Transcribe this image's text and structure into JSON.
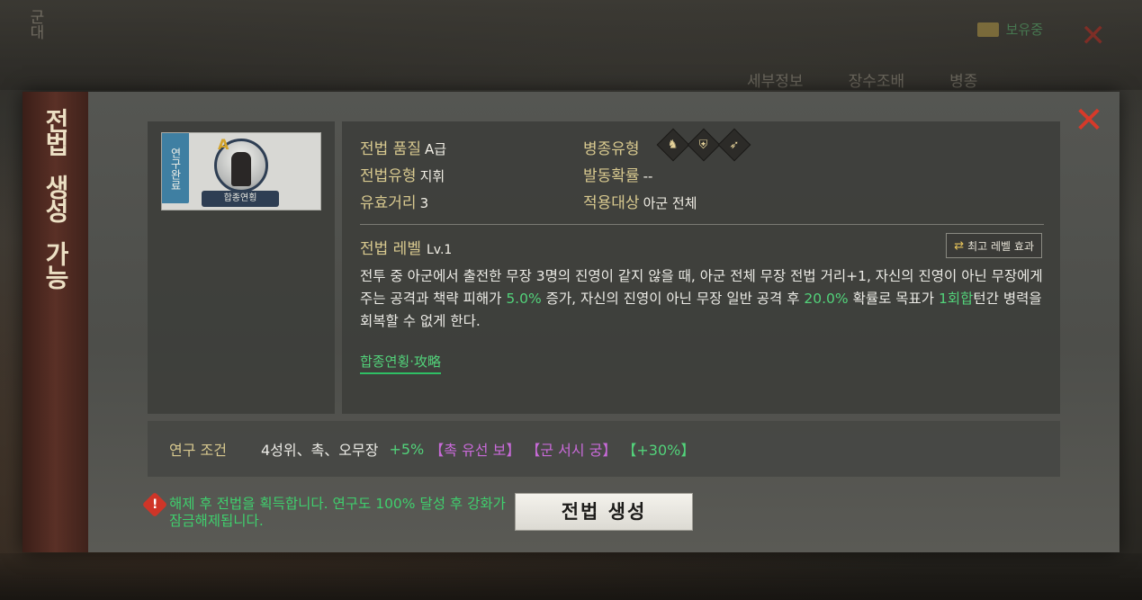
{
  "background": {
    "tabs": [
      "세부정보",
      "장수조배",
      "병종"
    ],
    "top_right_text": "보유중",
    "left_col_text": "군대"
  },
  "side_banner": {
    "line1": "전법",
    "line2": "생성",
    "line3": "가능"
  },
  "close_label": "✕",
  "card": {
    "ribbon": "연구완료",
    "grade": "A",
    "name": "합종연횡"
  },
  "attributes": {
    "quality_label": "전법 품질",
    "quality_value": "A급",
    "type_label": "전법유형",
    "type_value": "지휘",
    "range_label": "유효거리",
    "range_value": "3",
    "troop_label": "병종유형",
    "trigger_label": "발동확률",
    "trigger_value": "--",
    "target_label": "적용대상",
    "target_value": "아군 전체"
  },
  "troop_icons": [
    "cavalry-icon",
    "shield-icon",
    "bow-icon"
  ],
  "level": {
    "label": "전법 레벨",
    "value": "Lv.1"
  },
  "max_button": {
    "icon": "⇄",
    "label": "최고 레벨 효과"
  },
  "description": {
    "p1": "전투 중 아군에서 출전한 무장 3명의 진영이 같지 않을 때, 아군 전체 무장 전법 거리+1, 자신의 진영이 아닌 무장에게 주는 공격과 책략 피해가 ",
    "v1": "5.0%",
    "p2": " 증가, 자신의 진영이 아닌 무장 일반 공격 후 ",
    "v2": "20.0%",
    "p3": " 확률로 목표가 ",
    "v3": "1회합",
    "p4": "턴간 병력을 회복할 수 없게 한다."
  },
  "guide_link": "합종연횡·攻略",
  "condition": {
    "label": "연구 조건",
    "value": "4성위、촉、오무장",
    "bonus": "+5%",
    "tag1": "【촉 유선 보】",
    "tag2": "【군 서시 궁】",
    "tag3": "【+30%】"
  },
  "warning": {
    "icon": "!",
    "text": "해제 후 전법을 획득합니다. 연구도 100% 달성 후 강화가 잠금해제됩니다."
  },
  "create_button": "전법 생성"
}
